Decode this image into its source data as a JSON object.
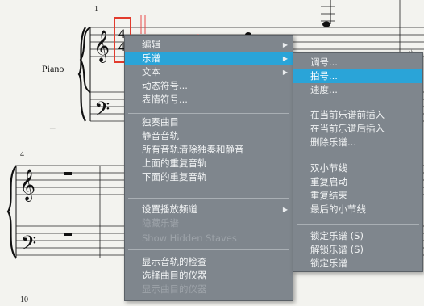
{
  "score": {
    "instrument": "Piano",
    "measure_numbers": [
      "1",
      "4",
      "10"
    ],
    "dash": "–"
  },
  "main_menu": {
    "items": [
      {
        "label": "编辑",
        "submenu": true
      },
      {
        "label": "乐谱",
        "submenu": true,
        "highlighted": true
      },
      {
        "label": "文本",
        "submenu": true
      },
      {
        "label": "动态符号..."
      },
      {
        "label": "表情符号..."
      },
      {
        "label": "独奏曲目"
      },
      {
        "label": "静音音轨"
      },
      {
        "label": "所有音轨清除独奏和静音"
      },
      {
        "label": "上面的重复音轨"
      },
      {
        "label": "下面的重复音轨"
      },
      {
        "label": "设置播放频道",
        "submenu": true
      },
      {
        "label": "隐藏乐谱",
        "disabled": true
      },
      {
        "label": "Show Hidden Staves",
        "disabled": true
      },
      {
        "label": "显示音轨的检查"
      },
      {
        "label": "选择曲目的仪器"
      },
      {
        "label": "显示曲目的仪器",
        "disabled": true
      }
    ]
  },
  "sub_menu": {
    "items": [
      {
        "label": "调号..."
      },
      {
        "label": "拍号...",
        "highlighted": true
      },
      {
        "label": "速度..."
      },
      {
        "label": "在当前乐谱前插入"
      },
      {
        "label": "在当前乐谱后插入"
      },
      {
        "label": "删除乐谱..."
      },
      {
        "label": "双小节线"
      },
      {
        "label": "重复启动"
      },
      {
        "label": "重复结束"
      },
      {
        "label": "最后的小节线"
      },
      {
        "label": "锁定乐谱 (S)"
      },
      {
        "label": "解锁乐谱 (S)"
      },
      {
        "label": "锁定乐谱"
      }
    ]
  },
  "colors": {
    "menu_bg": "#7f868d",
    "highlight": "#2aa4d8",
    "selection_box": "#e23b2d"
  }
}
